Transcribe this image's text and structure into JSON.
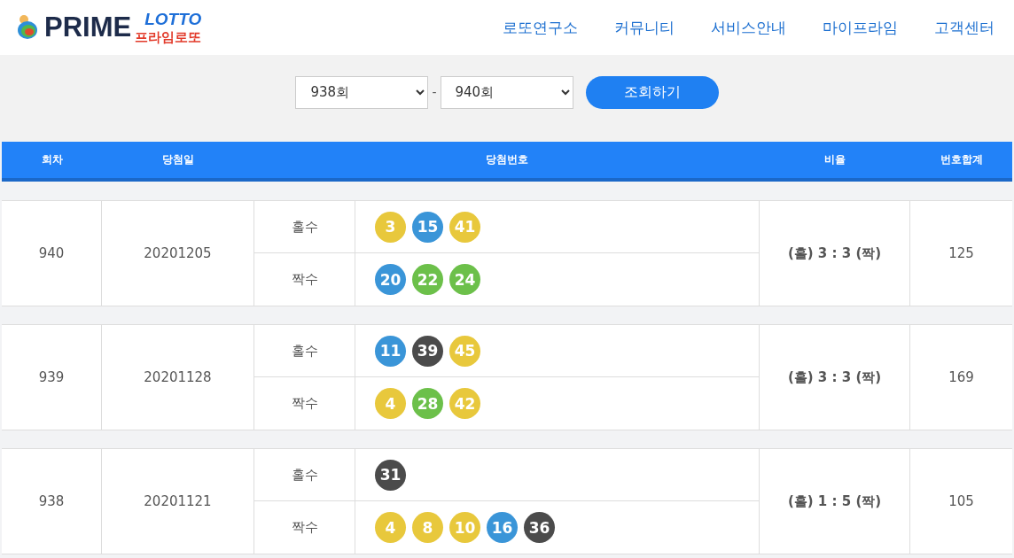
{
  "logo": {
    "brand": "PRIME",
    "sub_latin": "LOTTO",
    "sub_korean": "프라임로또"
  },
  "nav": [
    "로또연구소",
    "커뮤니티",
    "서비스안내",
    "마이프라임",
    "고객센터"
  ],
  "filter": {
    "from": "938회",
    "separator": "-",
    "to": "940회",
    "button": "조회하기"
  },
  "table": {
    "columns": [
      "회차",
      "당첨일",
      "당첨번호",
      "비율",
      "번호합계"
    ],
    "rows": [
      {
        "round": "940",
        "date": "20201205",
        "odd_label": "홀수",
        "odd": [
          {
            "number": "3",
            "color": "#e8c83c"
          },
          {
            "number": "15",
            "color": "#3a95d8"
          },
          {
            "number": "41",
            "color": "#e8c83c"
          }
        ],
        "even_label": "짝수",
        "even": [
          {
            "number": "20",
            "color": "#3a95d8"
          },
          {
            "number": "22",
            "color": "#6cc04a"
          },
          {
            "number": "24",
            "color": "#6cc04a"
          }
        ],
        "ratio": "(홀) 3 : 3 (짝)",
        "sum": "125"
      },
      {
        "round": "939",
        "date": "20201128",
        "odd_label": "홀수",
        "odd": [
          {
            "number": "11",
            "color": "#3a95d8"
          },
          {
            "number": "39",
            "color": "#4b4b4b"
          },
          {
            "number": "45",
            "color": "#e8c83c"
          }
        ],
        "even_label": "짝수",
        "even": [
          {
            "number": "4",
            "color": "#e8c83c"
          },
          {
            "number": "28",
            "color": "#6cc04a"
          },
          {
            "number": "42",
            "color": "#e8c83c"
          }
        ],
        "ratio": "(홀) 3 : 3 (짝)",
        "sum": "169"
      },
      {
        "round": "938",
        "date": "20201121",
        "odd_label": "홀수",
        "odd": [
          {
            "number": "31",
            "color": "#4b4b4b"
          }
        ],
        "even_label": "짝수",
        "even": [
          {
            "number": "4",
            "color": "#e8c83c"
          },
          {
            "number": "8",
            "color": "#e8c83c"
          },
          {
            "number": "10",
            "color": "#e8c83c"
          },
          {
            "number": "16",
            "color": "#3a95d8"
          },
          {
            "number": "36",
            "color": "#4b4b4b"
          }
        ],
        "ratio": "(홀) 1 : 5 (짝)",
        "sum": "105"
      }
    ]
  }
}
